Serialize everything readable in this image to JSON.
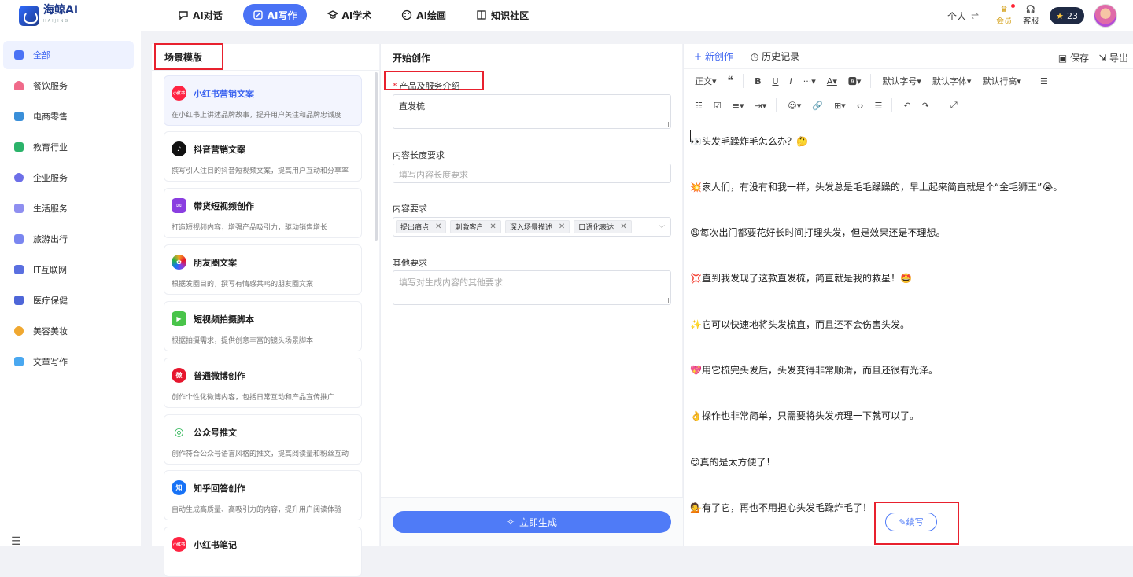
{
  "brand": {
    "name": "海鲸AI",
    "sub": "HAIJING"
  },
  "nav": [
    {
      "label": "AI对话",
      "icon": "chat-icon"
    },
    {
      "label": "AI写作",
      "icon": "write-icon",
      "active": true
    },
    {
      "label": "AI学术",
      "icon": "graduation-icon"
    },
    {
      "label": "AI绘画",
      "icon": "palette-icon"
    },
    {
      "label": "知识社区",
      "icon": "book-icon"
    }
  ],
  "topright": {
    "personal": "个人",
    "swap": "⇌",
    "vip": "会员",
    "service": "客服",
    "points": "23"
  },
  "sidebar": {
    "items": [
      {
        "label": "全部",
        "color": "#4a72f5",
        "active": true
      },
      {
        "label": "餐饮服务",
        "color": "#f06a8a"
      },
      {
        "label": "电商零售",
        "color": "#3a8fd9"
      },
      {
        "label": "教育行业",
        "color": "#2bb36a"
      },
      {
        "label": "企业服务",
        "color": "#6d6fe8"
      },
      {
        "label": "生活服务",
        "color": "#8f8ff0"
      },
      {
        "label": "旅游出行",
        "color": "#7a86f0"
      },
      {
        "label": "IT互联网",
        "color": "#5a6fe0"
      },
      {
        "label": "医疗保健",
        "color": "#4e66d8"
      },
      {
        "label": "美容美妆",
        "color": "#f0a830"
      },
      {
        "label": "文章写作",
        "color": "#4aa8f0"
      }
    ]
  },
  "scene": {
    "title": "场景模版",
    "cards": [
      {
        "title": "小红书营销文案",
        "desc": "在小红书上讲述品牌故事，提升用户关注和品牌忠诚度",
        "icon": "xiaohongshu-icon",
        "color": "#ff2442",
        "badge": "小红书",
        "active": true
      },
      {
        "title": "抖音营销文案",
        "desc": "撰写引人注目的抖音短视频文案，提高用户互动和分享率",
        "icon": "douyin-icon",
        "color": "#111111",
        "badge": "♪"
      },
      {
        "title": "带货短视频创作",
        "desc": "打造短视频内容，增强产品吸引力，驱动销售增长",
        "icon": "video-mail-icon",
        "color": "#8a3ee0",
        "badge": "✉"
      },
      {
        "title": "朋友圈文案",
        "desc": "根据发圈目的，撰写有情感共鸣的朋友圈文案",
        "icon": "moments-icon",
        "color": "#f7a51e",
        "badge": "✿"
      },
      {
        "title": "短视频拍摄脚本",
        "desc": "根据拍摄需求，提供创意丰富的镜头场景脚本",
        "icon": "camera-icon",
        "color": "#49c44a",
        "badge": "▶"
      },
      {
        "title": "普通微博创作",
        "desc": "创作个性化微博内容，包括日常互动和产品宣传推广",
        "icon": "weibo-icon",
        "color": "#e6162d",
        "badge": "微"
      },
      {
        "title": "公众号推文",
        "desc": "创作符合公众号语言风格的推文，提高阅读量和粉丝互动",
        "icon": "wechat-icon",
        "color": "#22b14c",
        "badge": "◎"
      },
      {
        "title": "知乎回答创作",
        "desc": "自动生成高质量、高吸引力的内容，提升用户阅读体验",
        "icon": "zhihu-icon",
        "color": "#1772f6",
        "badge": "知"
      },
      {
        "title": "小红书笔记",
        "desc": "",
        "icon": "xiaohongshu-icon",
        "color": "#ff2442",
        "badge": "小红书"
      }
    ]
  },
  "form": {
    "title": "开始创作",
    "product_label": "产品及服务介绍",
    "product_value": "直发梳",
    "length_label": "内容长度要求",
    "length_placeholder": "填写内容长度要求",
    "content_label": "内容要求",
    "tags": [
      "提出痛点",
      "刺激客户",
      "深入场景描述",
      "口语化表达"
    ],
    "other_label": "其他要求",
    "other_placeholder": "填写对生成内容的其他要求",
    "generate": "立即生成"
  },
  "editor": {
    "new": "+ 新创作",
    "history": "历史记录",
    "save": "保存",
    "export": "导出",
    "toolbar1": [
      "正文▾",
      "❝",
      "B",
      "U",
      "I",
      "···▾",
      "A▾",
      "🅰▾",
      "默认字号▾",
      "默认字体▾",
      "默认行高▾",
      "☰"
    ],
    "toolbar2": [
      "☷",
      "☑",
      "≡▾",
      "⇥▾",
      "☺▾",
      "🔗",
      "⊞▾",
      "‹›",
      "☰",
      "↶",
      "↷",
      "⤢"
    ],
    "lines": [
      "👀头发毛躁炸毛怎么办？🤔",
      "💥家人们，有没有和我一样，头发总是毛毛躁躁的，早上起来简直就是个“金毛狮王”😭。",
      "😫每次出门都要花好长时间打理头发，但是效果还是不理想。",
      "💢直到我发现了这款直发梳，简直就是我的救星！🤩",
      "✨它可以快速地将头发梳直，而且还不会伤害头发。",
      "💖用它梳完头发后，头发变得非常顺滑，而且还很有光泽。",
      "👌操作也非常简单，只需要将头发梳理一下就可以了。",
      "😍真的是太方便了！",
      "💁有了它，再也不用担心头发毛躁炸毛了！"
    ],
    "continue": "续写"
  }
}
